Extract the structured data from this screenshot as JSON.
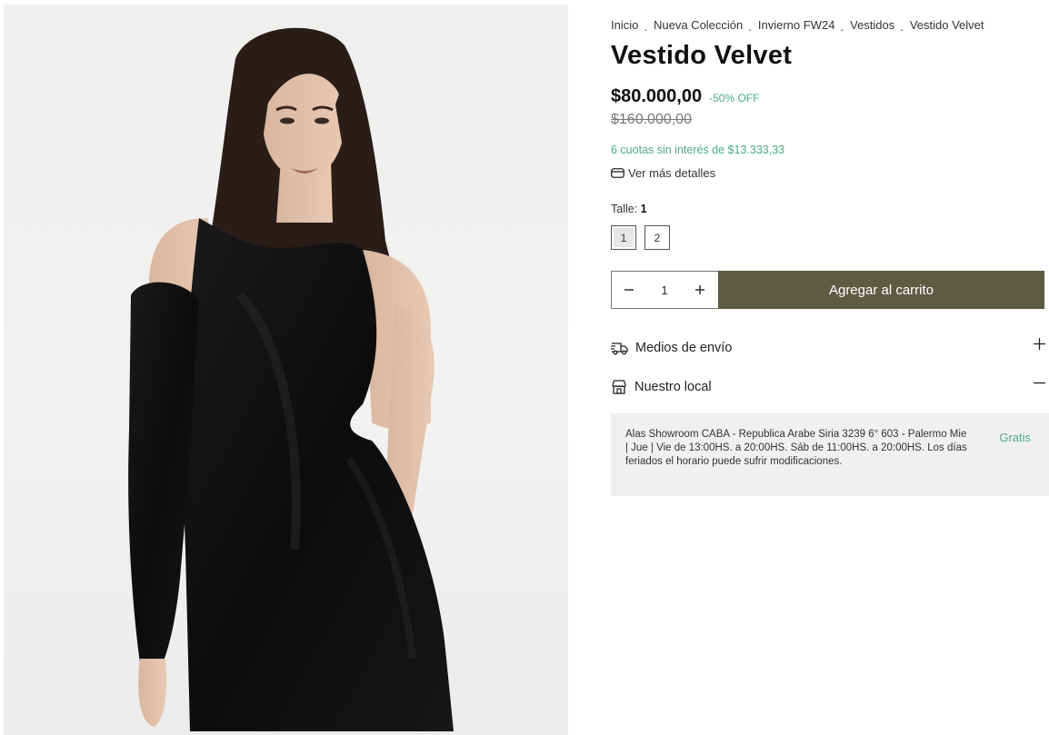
{
  "breadcrumb": {
    "items": [
      "Inicio",
      "Nueva Colección",
      "Invierno FW24",
      "Vestidos",
      "Vestido Velvet"
    ],
    "separator": "."
  },
  "product": {
    "title": "Vestido Velvet",
    "price": "$80.000,00",
    "discount": "-50% OFF",
    "compare_price": "$160.000,00",
    "installments": "6 cuotas sin interés de $13.333,33",
    "details_link": "Ver más detalles",
    "image_alt_icon": "product-photo"
  },
  "size": {
    "label": "Talle:",
    "selected": "1",
    "options": [
      "1",
      "2"
    ]
  },
  "cart": {
    "quantity": "1",
    "add_label": "Agregar al carrito"
  },
  "shipping": {
    "label": "Medios de envío",
    "toggle": "+",
    "icon": "truck-icon"
  },
  "store": {
    "label": "Nuestro local",
    "toggle": "−",
    "icon": "store-icon",
    "description": "Alas Showroom CABA - Republica Arabe Siria 3239 6° 603 - Palermo Mie | Jue | Vie de 13:00HS. a 20:00HS. Sáb de 11:00HS. a 20:00HS. Los días feriados el horario puede sufrir modificaciones.",
    "price": "Gratis"
  },
  "colors": {
    "accent_green": "#4daa82",
    "button_olive": "#5e5b43",
    "panel_gray": "#f0f0f0"
  }
}
